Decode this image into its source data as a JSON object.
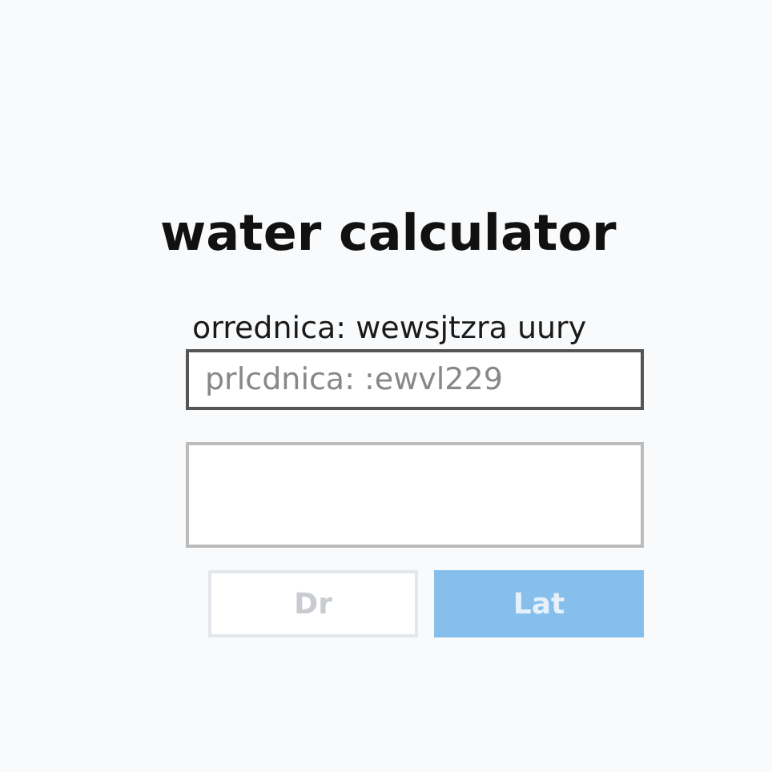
{
  "title": "water calculator",
  "fields": [
    {
      "kind": "labeled",
      "label": "orrednica: wewsjtzra uury",
      "placeholder": "prlcdnica: :ewvl229"
    },
    {
      "kind": "blank"
    }
  ],
  "buttons": [
    {
      "label": "Dr",
      "kind": "secondary"
    },
    {
      "label": "Lat",
      "kind": "primary"
    }
  ]
}
